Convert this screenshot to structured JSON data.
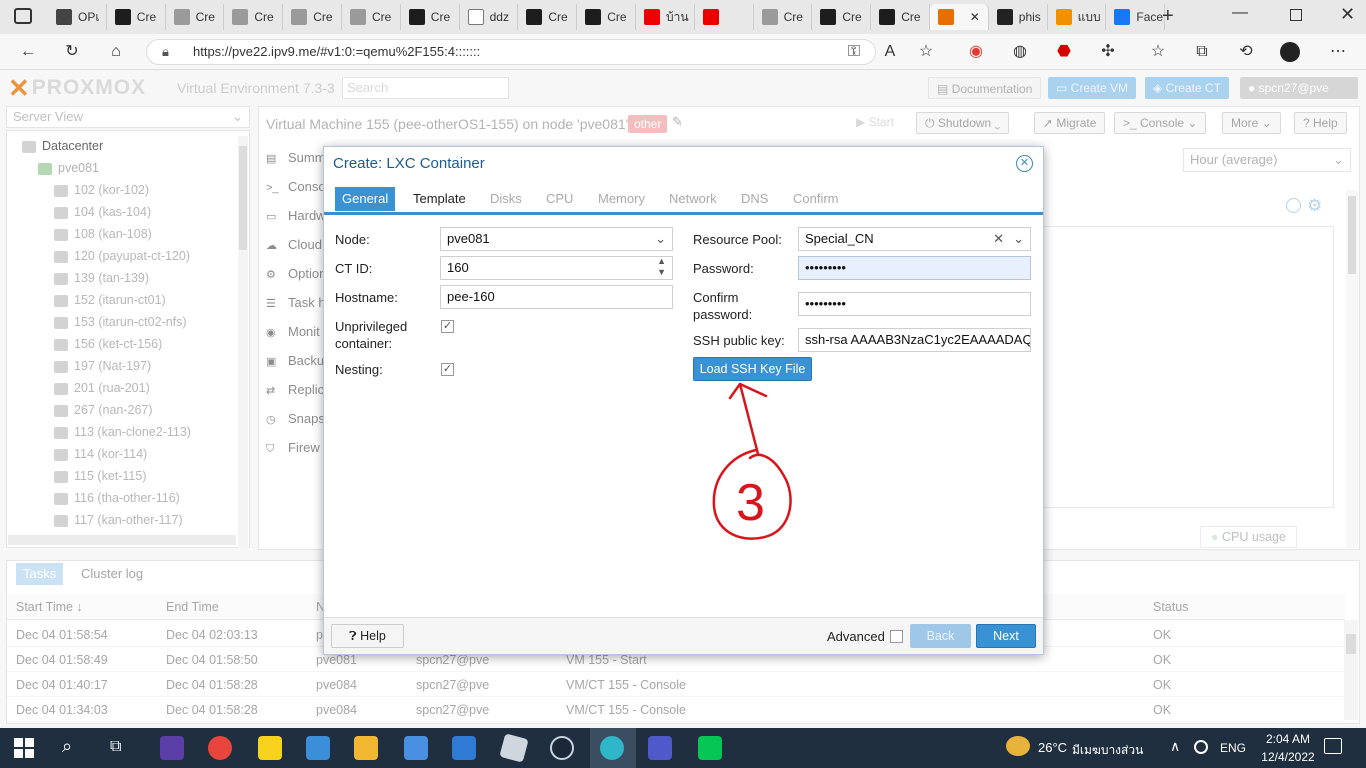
{
  "browser": {
    "tabs": [
      {
        "label": "OPเ",
        "active": false
      },
      {
        "label": "Cre",
        "active": false
      },
      {
        "label": "Cre",
        "active": false
      },
      {
        "label": "Cre",
        "active": false
      },
      {
        "label": "Cre",
        "active": false
      },
      {
        "label": "Cre",
        "active": false
      },
      {
        "label": "Cre",
        "active": false
      },
      {
        "label": "ddz",
        "active": false
      },
      {
        "label": "Cre",
        "active": false
      },
      {
        "label": "Cre",
        "active": false
      },
      {
        "label": "บ้าน",
        "active": false
      },
      {
        "label": "",
        "active": false
      },
      {
        "label": "Cre",
        "active": false
      },
      {
        "label": "Cre",
        "active": false
      },
      {
        "label": "Cre",
        "active": false
      },
      {
        "label": "",
        "active": true
      },
      {
        "label": "phis",
        "active": false
      },
      {
        "label": "แบบ",
        "active": false
      },
      {
        "label": "Face",
        "active": false
      }
    ],
    "url": "https://pve22.ipv9.me/#v1:0:=qemu%2F155:4:::::::"
  },
  "pve": {
    "logo": "PROXMOX",
    "product": "Virtual Environment 7.3-3",
    "search_placeholder": "Search",
    "documentation": "Documentation",
    "create_vm": "Create VM",
    "create_ct": "Create CT",
    "user": "spcn27@pve",
    "server_view": "Server View"
  },
  "tree": {
    "datacenter": "Datacenter",
    "node": "pve081",
    "items": [
      "102 (kor-102)",
      "104 (kas-104)",
      "108 (kan-108)",
      "120 (payupat-ct-120)",
      "139 (tan-139)",
      "152 (itarun-ct01)",
      "153 (itarun-ct02-nfs)",
      "156 (ket-ct-156)",
      "197 (Nat-197)",
      "201 (rua-201)",
      "267 (nan-267)",
      "113 (kan-clone2-113)",
      "114 (kor-114)",
      "115 (ket-115)",
      "116 (tha-other-116)",
      "117 (kan-other-117)"
    ]
  },
  "vm": {
    "title": "Virtual Machine 155 (pee-otherOS1-155) on node 'pve081'",
    "tag": "other",
    "start": "Start",
    "shutdown": "Shutdown",
    "migrate": "Migrate",
    "console": "Console",
    "more": "More",
    "help": "Help",
    "timeframe": "Hour (average)",
    "cpu_usage": "CPU usage",
    "side": [
      "Summ",
      "Conso",
      "Hardw",
      "Cloud",
      "Option",
      "Task h",
      "Monit",
      "Backu",
      "Replic",
      "Snaps",
      "Firew"
    ]
  },
  "tasks": {
    "tabs": [
      "Tasks",
      "Cluster log"
    ],
    "headers": {
      "start": "Start Time ↓",
      "end": "End Time",
      "node": "N",
      "status": "Status"
    },
    "rows": [
      {
        "start": "Dec 04 01:58:54",
        "end": "Dec 04 02:03:13",
        "node": "p",
        "user": "",
        "desc": "",
        "status": "OK"
      },
      {
        "start": "Dec 04 01:58:49",
        "end": "Dec 04 01:58:50",
        "node": "pve081",
        "user": "spcn27@pve",
        "desc": "VM 155 - Start",
        "status": "OK"
      },
      {
        "start": "Dec 04 01:40:17",
        "end": "Dec 04 01:58:28",
        "node": "pve084",
        "user": "spcn27@pve",
        "desc": "VM/CT 155 - Console",
        "status": "OK"
      },
      {
        "start": "Dec 04 01:34:03",
        "end": "Dec 04 01:58:28",
        "node": "pve084",
        "user": "spcn27@pve",
        "desc": "VM/CT 155 - Console",
        "status": "OK"
      }
    ]
  },
  "dialog": {
    "title": "Create: LXC Container",
    "tabs": [
      "General",
      "Template",
      "Disks",
      "CPU",
      "Memory",
      "Network",
      "DNS",
      "Confirm"
    ],
    "node_label": "Node:",
    "node_value": "pve081",
    "ctid_label": "CT ID:",
    "ctid_value": "160",
    "hostname_label": "Hostname:",
    "hostname_value": "pee-160",
    "unpriv_label": "Unprivileged container:",
    "nesting_label": "Nesting:",
    "unprivileged": true,
    "nesting": true,
    "pool_label": "Resource Pool:",
    "pool_value": "Special_CN",
    "password_label": "Password:",
    "password_value": "•••••••••",
    "confirm_label": "Confirm password:",
    "confirm_value": "•••••••••",
    "ssh_label": "SSH public key:",
    "ssh_value": "ssh-rsa AAAAB3NzaC1yc2EAAAADAQ",
    "load_ssh": "Load SSH Key File",
    "help": "Help",
    "advanced": "Advanced",
    "back": "Back",
    "next": "Next"
  },
  "annotation": {
    "text": "3",
    "color": "#d9141b"
  },
  "taskbar": {
    "weather": "26°C",
    "weather_text": "มีเมฆบางส่วน",
    "lang": "ENG",
    "time": "2:04 AM",
    "date": "12/4/2022"
  }
}
